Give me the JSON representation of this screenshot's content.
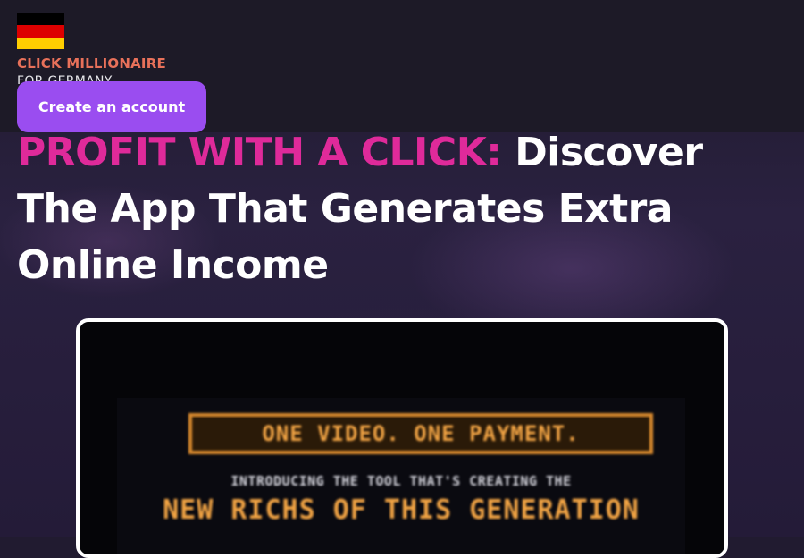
{
  "header": {
    "flag": {
      "name": "germany-flag-icon",
      "colors": [
        "#000000",
        "#dd0000",
        "#ffce00"
      ]
    },
    "brand_name": "CLICK MILLIONAIRE",
    "brand_sub": "FOR GERMANY",
    "cta_label": "Create an account"
  },
  "hero": {
    "highlight": "PROFIT WITH A CLICK:",
    "rest": " Discover The App That Generates Extra Online Income",
    "highlight_color": "#df2a9a"
  },
  "video": {
    "title_line1": "ONE VIDEO. ONE PAYMENT.",
    "subtitle": "INTRODUCING THE TOOL THAT'S CREATING THE",
    "title_line2": "NEW RICHS OF THIS GENERATION"
  },
  "colors": {
    "accent_button": "#9a4df0",
    "brand": "#e8715a",
    "video_accent": "#f2a444"
  }
}
